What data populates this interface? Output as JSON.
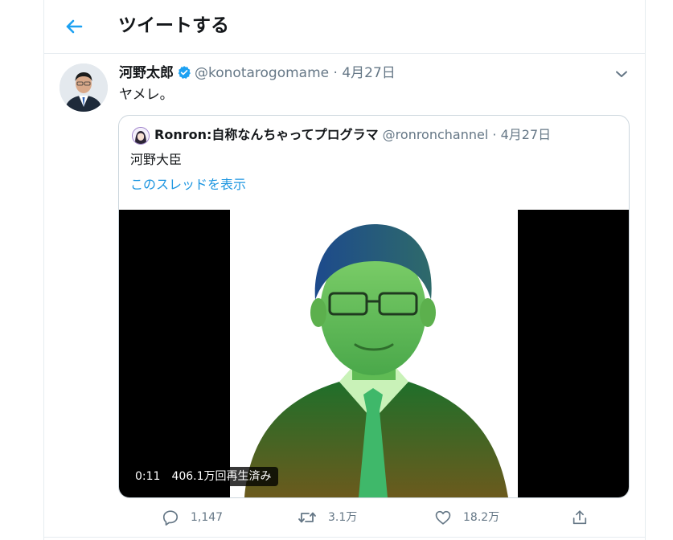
{
  "header": {
    "title": "ツイートする",
    "back_icon": "arrow-left-icon"
  },
  "tweet": {
    "author_name": "河野太郎",
    "verified_icon": "verified-badge-icon",
    "handle": "@konotarogomame",
    "separator": "·",
    "date": "4月27日",
    "text": "ヤメレ。",
    "menu_icon": "chevron-down-icon"
  },
  "quote": {
    "author_name": "Ronron:自称なんちゃってプログラマ",
    "handle": "@ronronchannel",
    "separator": "·",
    "date": "4月27日",
    "text": "河野大臣",
    "thread_link": "このスレッドを表示",
    "video": {
      "duration": "0:11",
      "views": "406.1万回再生済み"
    }
  },
  "actions": {
    "reply_count": "1,147",
    "retweet_count": "3.1万",
    "like_count": "18.2万",
    "icons": [
      "reply-icon",
      "retweet-icon",
      "like-icon",
      "share-icon"
    ]
  },
  "colors": {
    "accent": "#1da1f2",
    "link": "#1b95e0",
    "secondary_text": "#657786",
    "border": "#e6ecf0"
  }
}
